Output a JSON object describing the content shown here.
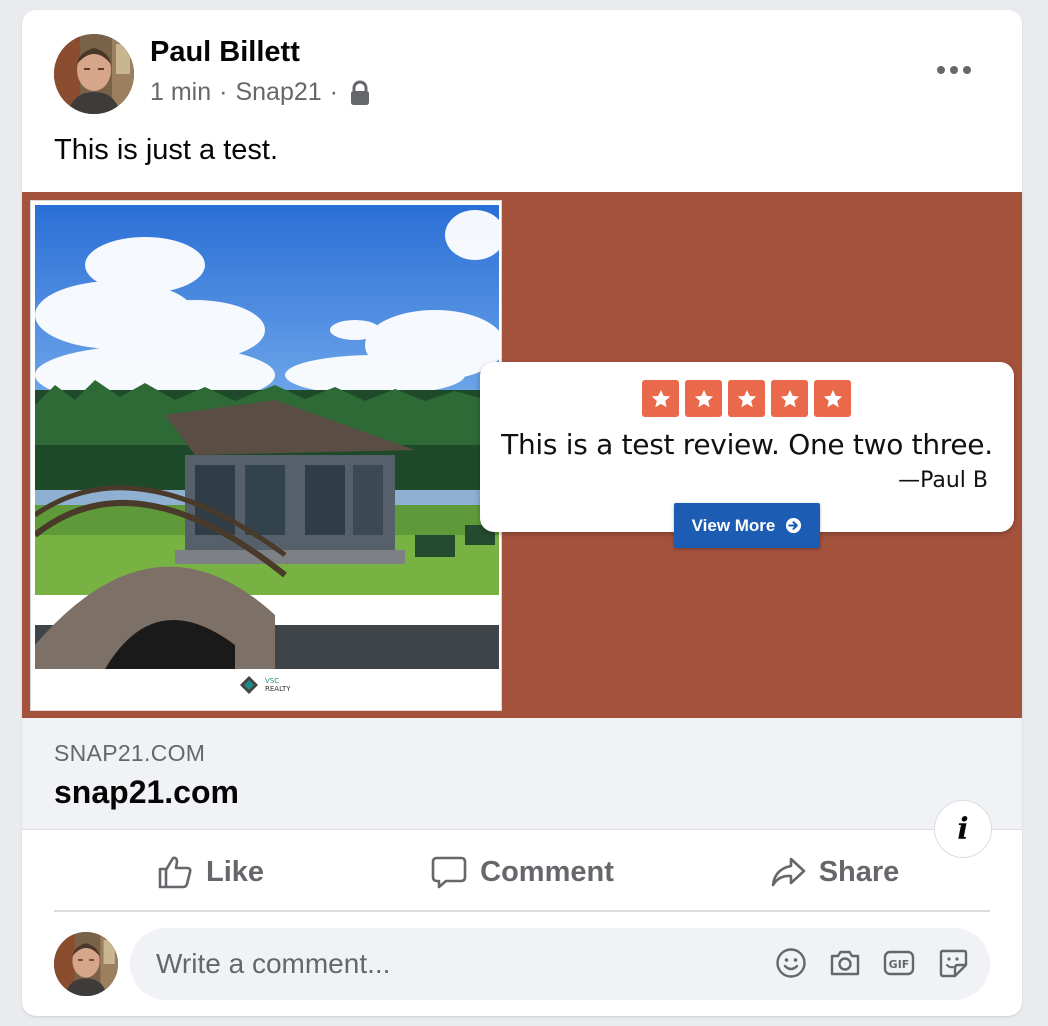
{
  "post": {
    "author": "Paul Billett",
    "time": "1 min",
    "source": "Snap21",
    "separator": "·",
    "text": "This is just a test."
  },
  "review": {
    "stars": 5,
    "text": "This is a test review. One two three.",
    "author": "—Paul B",
    "button_label": "View More"
  },
  "brand": {
    "line1": "VSC",
    "line2": "REALTY"
  },
  "link": {
    "domain": "SNAP21.COM",
    "title": "snap21.com"
  },
  "actions": {
    "like": "Like",
    "comment": "Comment",
    "share": "Share"
  },
  "comment": {
    "placeholder": "Write a comment..."
  },
  "colors": {
    "media_background": "#a5523d",
    "star_color": "#e9694a",
    "button_blue": "#1d5cb3",
    "meta_grey": "#65676b"
  },
  "icons": {
    "more": "more-dots-icon",
    "privacy": "lock-icon",
    "info": "info-icon",
    "like": "thumbs-up-icon",
    "comment": "speech-bubble-icon",
    "share": "share-arrow-icon",
    "emoji": "smiley-icon",
    "camera": "camera-icon",
    "gif": "gif-icon",
    "sticker": "sticker-icon"
  }
}
